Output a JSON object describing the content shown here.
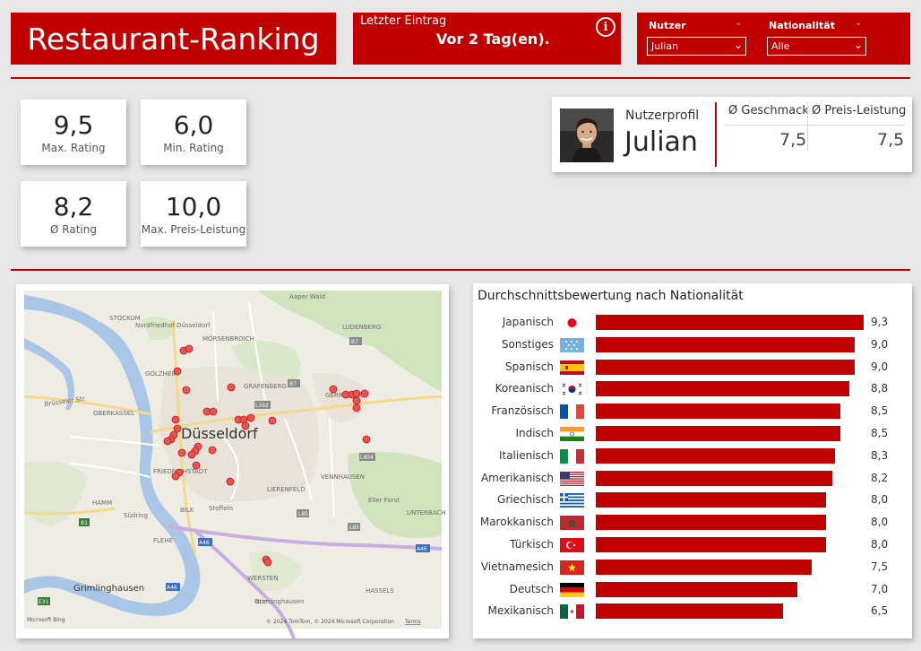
{
  "header": {
    "title": "Restaurant-Ranking",
    "last_entry_label": "Letzter Eintrag",
    "last_entry_value": "Vor 2 Tag(en).",
    "info_symbol": "i"
  },
  "filters": {
    "user_label": "Nutzer",
    "user_value": "Julian",
    "nationality_label": "Nationalität",
    "nationality_value": "Alle"
  },
  "kpis": [
    {
      "value": "9,5",
      "label": "Max. Rating"
    },
    {
      "value": "6,0",
      "label": "Min. Rating"
    },
    {
      "value": "8,2",
      "label": "Ø Rating"
    },
    {
      "value": "10,0",
      "label": "Max. Preis-Leistung"
    }
  ],
  "profile": {
    "label": "Nutzerprofil",
    "name": "Julian",
    "taste_header": "Ø Geschmack",
    "value_header": "Ø Preis-Leistung",
    "taste_value": "7,5",
    "value_value": "7,5"
  },
  "map": {
    "city": "Düsseldorf",
    "attribution": "© 2024 TomTom, © 2024 Microsoft Corporation",
    "terms": "Terms",
    "bing": "Microsoft Bing",
    "places": [
      "Aaper Wald",
      "STOCKUM",
      "Nordfriedhof Düsseldorf",
      "LUDENBERG",
      "MÖRSENBROICH",
      "GOLZHEIM",
      "GRAFENBERG",
      "GERRESHEIM",
      "Brüsseler Str.",
      "OBERKASSEL",
      "FRIEDRICHSTADT",
      "VENNHAUSEN",
      "LIERENFELD",
      "HAMM",
      "BILK",
      "Stoffeln",
      "Südring",
      "Eller Forst",
      "UNTERBACH",
      "FLEHE",
      "WERSTEN",
      "HASSELS",
      "Grimlinghausen",
      "Itter"
    ],
    "roads": [
      "B7",
      "B7",
      "L392",
      "L404",
      "L85",
      "L85",
      "B1",
      "A46",
      "A46",
      "A46",
      "E31"
    ]
  },
  "chart_data": {
    "type": "bar",
    "title": "Durchschnittsbewertung nach Nationalität",
    "categories": [
      "Japanisch",
      "Sonstiges",
      "Spanisch",
      "Koreanisch",
      "Französisch",
      "Indisch",
      "Italienisch",
      "Amerikanisch",
      "Griechisch",
      "Marokkanisch",
      "Türkisch",
      "Vietnamesich",
      "Deutsch",
      "Mexikanisch"
    ],
    "values": [
      9.3,
      9.0,
      9.0,
      8.8,
      8.5,
      8.5,
      8.3,
      8.2,
      8.0,
      8.0,
      8.0,
      7.5,
      7.0,
      6.5
    ],
    "value_labels": [
      "9,3",
      "9,0",
      "9,0",
      "8,8",
      "8,5",
      "8,5",
      "8,3",
      "8,2",
      "8,0",
      "8,0",
      "8,0",
      "7,5",
      "7,0",
      "6,5"
    ],
    "flags": [
      "japan-flag",
      "sonstiges-flag",
      "spain-flag",
      "korea-flag",
      "france-flag",
      "india-flag",
      "italy-flag",
      "usa-flag",
      "greece-flag",
      "morocco-flag",
      "turkey-flag",
      "vietnam-flag",
      "germany-flag",
      "mexico-flag"
    ],
    "bar_color": "#c00000",
    "xlim": [
      0,
      9.3
    ]
  },
  "colors": {
    "accent": "#c00000",
    "background": "#e7e7e7"
  }
}
